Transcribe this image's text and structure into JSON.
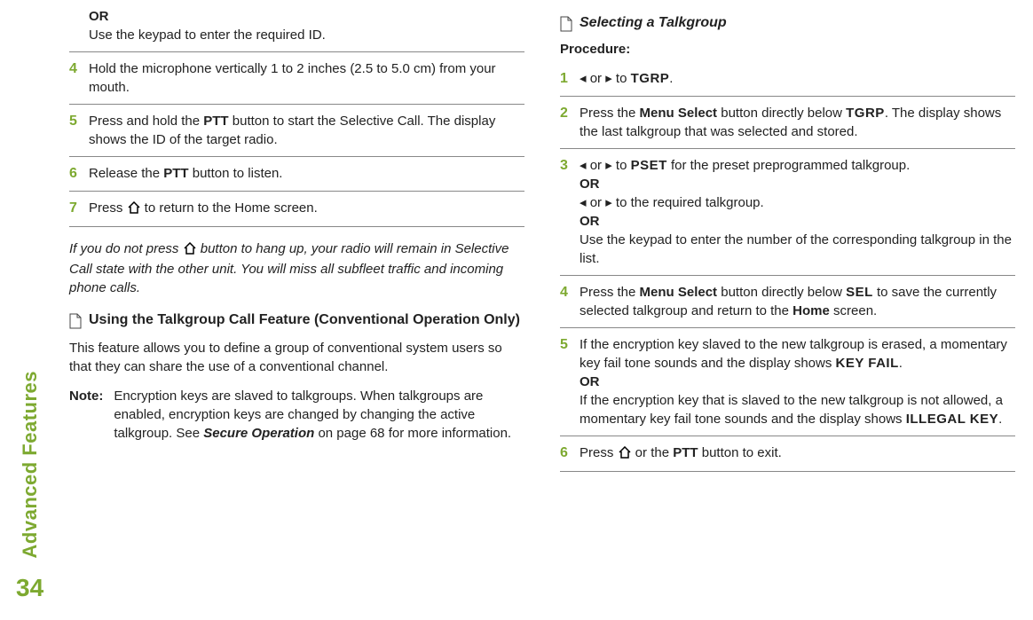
{
  "sidebar": {
    "label": "Advanced Features",
    "page": "34"
  },
  "col1": {
    "pre": {
      "or": "OR",
      "line": "Use the keypad to enter the required ID."
    },
    "step4": {
      "num": "4",
      "text": "Hold the microphone vertically 1 to 2 inches (2.5 to 5.0 cm) from your mouth."
    },
    "step5": {
      "num": "5",
      "pre": "Press and hold the ",
      "bold1": "PTT",
      "post1": " button to start the Selective Call. The display shows the ID of the target radio."
    },
    "step6": {
      "num": "6",
      "pre": "Release the ",
      "bold1": "PTT",
      "post1": " button to listen."
    },
    "step7": {
      "num": "7",
      "pre": "Press ",
      "post": " to return to the Home screen."
    },
    "italic": {
      "pre": "If you do not press ",
      "post": " button to hang up, your radio will remain in Selective Call state with the other unit. You will miss all subfleet traffic and incoming phone calls."
    },
    "section": {
      "title": "Using the Talkgroup Call Feature (Conventional Operation Only)"
    },
    "body": "This feature allows you to define a group of conventional system users so that they can share the use of a conventional channel.",
    "note": {
      "label": "Note:",
      "pre": "Encryption keys are slaved to talkgroups. When talkgroups are enabled, encryption keys are changed by changing the active talkgroup. See ",
      "linkbold": "Secure Operation",
      "post": " on page 68 for more information."
    }
  },
  "col2": {
    "section": {
      "title": "Selecting a Talkgroup"
    },
    "procedure": "Procedure:",
    "step1": {
      "num": "1",
      "left": "◂",
      "or": " or ",
      "right": "▸",
      "to": " to ",
      "disp": "TGRP",
      "end": "."
    },
    "step2": {
      "num": "2",
      "pre": "Press the ",
      "b1": "Menu Select",
      "mid1": " button directly below ",
      "disp": "TGRP",
      "post": ". The display shows the last talkgroup that was selected and stored."
    },
    "step3": {
      "num": "3",
      "line1_left": "◂",
      "line1_or": " or ",
      "line1_right": "▸",
      "line1_to": " to ",
      "line1_disp": "PSET",
      "line1_post": " for the preset preprogrammed talkgroup.",
      "or1": "OR",
      "line2_left": "◂",
      "line2_or": " or ",
      "line2_right": "▸",
      "line2_post": " to the required talkgroup.",
      "or2": "OR",
      "line3": "Use the keypad to enter the number of the corresponding talkgroup in the list."
    },
    "step4": {
      "num": "4",
      "pre": "Press the ",
      "b1": "Menu Select",
      "mid1": " button directly below ",
      "disp": "SEL",
      "mid2": " to save the currently selected talkgroup and return to the ",
      "b2": "Home",
      "post": " screen."
    },
    "step5": {
      "num": "5",
      "pre": "If the encryption key slaved to the new talkgroup is erased, a momentary key fail tone sounds and the display shows ",
      "disp1": "KEY FAIL",
      "dot1": ".",
      "or": "OR",
      "mid": "If the encryption key that is slaved to the new talkgroup is not allowed, a momentary key fail tone sounds and the display shows ",
      "disp2": "ILLEGAL KEY",
      "dot2": "."
    },
    "step6": {
      "num": "6",
      "pre": "Press ",
      "mid": " or the ",
      "b1": "PTT",
      "post": " button to exit."
    }
  }
}
